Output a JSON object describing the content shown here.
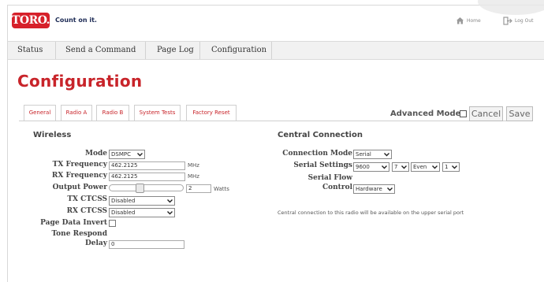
{
  "header": {
    "logo": "TORO.",
    "tagline": "Count on it.",
    "home_label": "Home",
    "logout_label": "Log Out"
  },
  "nav": {
    "items": [
      {
        "label": "Status"
      },
      {
        "label": "Send a Command"
      },
      {
        "label": "Page Log"
      },
      {
        "label": "Configuration"
      }
    ]
  },
  "page": {
    "title": "Configuration"
  },
  "tabs": [
    {
      "label": "General"
    },
    {
      "label": "Radio A"
    },
    {
      "label": "Radio B"
    },
    {
      "label": "System Tests"
    },
    {
      "label": "Factory Reset"
    }
  ],
  "toolbar": {
    "advanced_label": "Advanced Mode",
    "advanced_checked": false,
    "cancel_label": "Cancel",
    "save_label": "Save"
  },
  "wireless": {
    "title": "Wireless",
    "mode_label": "Mode",
    "mode_value": "DSMPC",
    "tx_label": "TX Frequency",
    "tx_value": "462.2125",
    "tx_unit": "MHz",
    "rx_label": "RX Frequency",
    "rx_value": "462.2125",
    "rx_unit": "MHz",
    "power_label": "Output Power",
    "power_level": 0.4,
    "power_value": "2",
    "power_unit": "Watts",
    "tx_ctcss_label": "TX CTCSS",
    "tx_ctcss_value": "Disabled",
    "rx_ctcss_label": "RX CTCSS",
    "rx_ctcss_value": "Disabled",
    "page_invert_label": "Page Data Invert",
    "page_invert_checked": false,
    "tone_label_1": "Tone Respond",
    "tone_label_2": "Delay",
    "tone_value": "0"
  },
  "central": {
    "title": "Central Connection",
    "mode_label": "Connection Mode",
    "mode_value": "Serial",
    "serial_label": "Serial Settings",
    "baud_value": "9600",
    "bits_value": "7",
    "parity_value": "Even",
    "stop_value": "1",
    "flow_label_1": "Serial Flow",
    "flow_label_2": "Control",
    "flow_value": "Hardware",
    "note": "Central connection to this radio will be available on the upper serial port"
  }
}
